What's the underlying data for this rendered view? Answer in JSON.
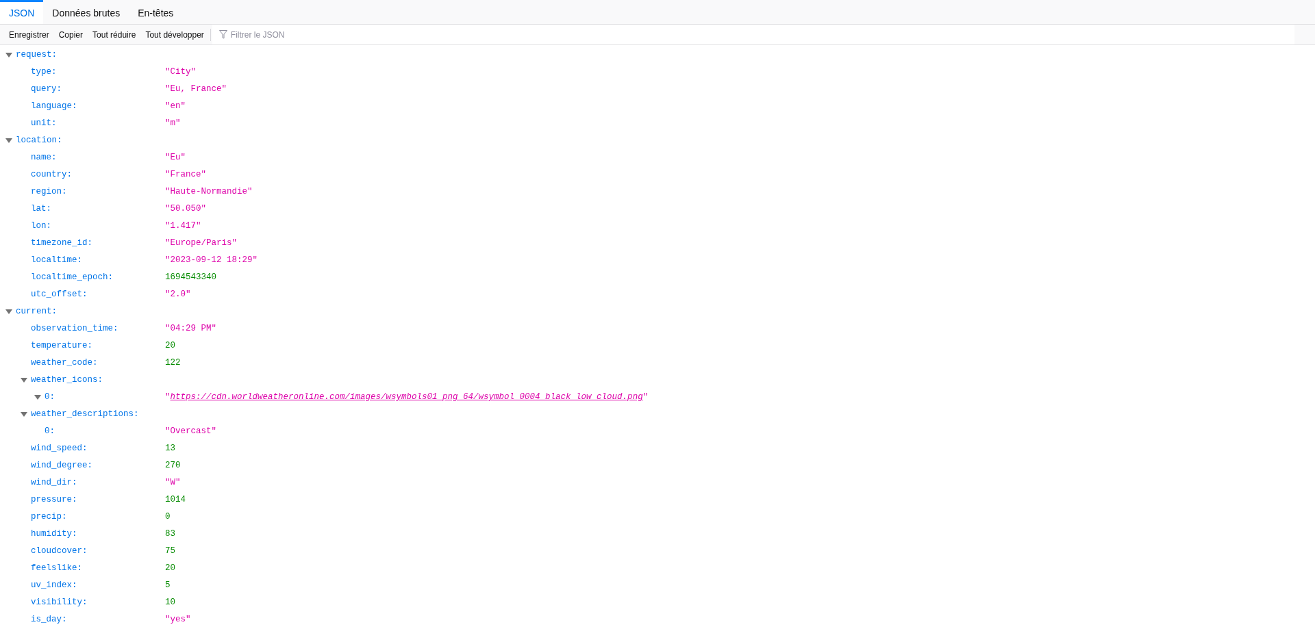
{
  "tabs": [
    {
      "label": "JSON",
      "selected": true
    },
    {
      "label": "Données brutes",
      "selected": false
    },
    {
      "label": "En-têtes",
      "selected": false
    }
  ],
  "toolbar": {
    "buttons": [
      "Enregistrer",
      "Copier",
      "Tout réduire",
      "Tout développer"
    ],
    "filter": {
      "placeholder": "Filtrer le JSON"
    }
  },
  "tree": [
    {
      "key": "request:",
      "expanded": true,
      "children": [
        {
          "key": "type:",
          "value": "\"City\"",
          "kind": "string"
        },
        {
          "key": "query:",
          "value": "\"Eu, France\"",
          "kind": "string"
        },
        {
          "key": "language:",
          "value": "\"en\"",
          "kind": "string"
        },
        {
          "key": "unit:",
          "value": "\"m\"",
          "kind": "string"
        }
      ]
    },
    {
      "key": "location:",
      "expanded": true,
      "children": [
        {
          "key": "name:",
          "value": "\"Eu\"",
          "kind": "string"
        },
        {
          "key": "country:",
          "value": "\"France\"",
          "kind": "string"
        },
        {
          "key": "region:",
          "value": "\"Haute-Normandie\"",
          "kind": "string"
        },
        {
          "key": "lat:",
          "value": "\"50.050\"",
          "kind": "string"
        },
        {
          "key": "lon:",
          "value": "\"1.417\"",
          "kind": "string"
        },
        {
          "key": "timezone_id:",
          "value": "\"Europe/Paris\"",
          "kind": "string"
        },
        {
          "key": "localtime:",
          "value": "\"2023-09-12 18:29\"",
          "kind": "string"
        },
        {
          "key": "localtime_epoch:",
          "value": "1694543340",
          "kind": "number"
        },
        {
          "key": "utc_offset:",
          "value": "\"2.0\"",
          "kind": "string"
        }
      ]
    },
    {
      "key": "current:",
      "expanded": true,
      "children": [
        {
          "key": "observation_time:",
          "value": "\"04:29 PM\"",
          "kind": "string"
        },
        {
          "key": "temperature:",
          "value": "20",
          "kind": "number"
        },
        {
          "key": "weather_code:",
          "value": "122",
          "kind": "number"
        },
        {
          "key": "weather_icons:",
          "expanded": true,
          "children": [
            {
              "key": "0:",
              "expanded": true,
              "kind": "link",
              "quote": "\"",
              "value": "https://cdn.worldweatheronline.com/images/wsymbols01_png_64/wsymbol_0004_black_low_cloud.png"
            }
          ]
        },
        {
          "key": "weather_descriptions:",
          "expanded": true,
          "children": [
            {
              "key": "0:",
              "value": "\"Overcast\"",
              "kind": "string"
            }
          ]
        },
        {
          "key": "wind_speed:",
          "value": "13",
          "kind": "number"
        },
        {
          "key": "wind_degree:",
          "value": "270",
          "kind": "number"
        },
        {
          "key": "wind_dir:",
          "value": "\"W\"",
          "kind": "string"
        },
        {
          "key": "pressure:",
          "value": "1014",
          "kind": "number"
        },
        {
          "key": "precip:",
          "value": "0",
          "kind": "number"
        },
        {
          "key": "humidity:",
          "value": "83",
          "kind": "number"
        },
        {
          "key": "cloudcover:",
          "value": "75",
          "kind": "number"
        },
        {
          "key": "feelslike:",
          "value": "20",
          "kind": "number"
        },
        {
          "key": "uv_index:",
          "value": "5",
          "kind": "number"
        },
        {
          "key": "visibility:",
          "value": "10",
          "kind": "number"
        },
        {
          "key": "is_day:",
          "value": "\"yes\"",
          "kind": "string"
        }
      ]
    }
  ]
}
